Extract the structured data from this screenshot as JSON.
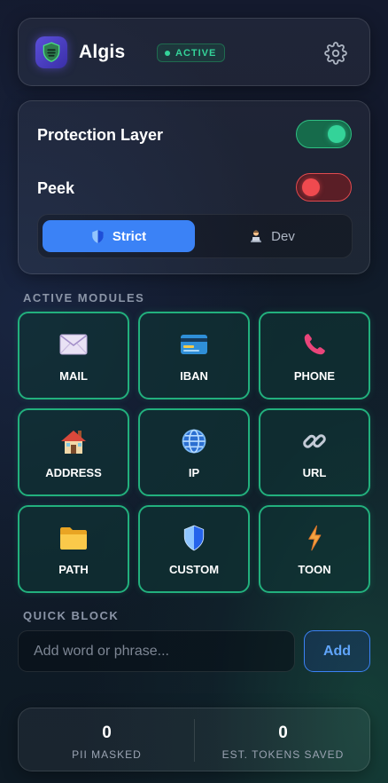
{
  "header": {
    "app_name": "Algis",
    "status": "ACTIVE",
    "logo_icon": "shield-logo-icon",
    "settings_icon": "gear-icon"
  },
  "settings": {
    "protection_layer": {
      "label": "Protection Layer",
      "enabled": true
    },
    "peek": {
      "label": "Peek",
      "enabled": false
    },
    "modes": [
      {
        "label": "Strict",
        "icon": "shield-icon",
        "selected": true
      },
      {
        "label": "Dev",
        "icon": "technologist-icon",
        "selected": false
      }
    ]
  },
  "modules": {
    "section_label": "ACTIVE MODULES",
    "items": [
      {
        "label": "MAIL",
        "icon": "envelope-icon"
      },
      {
        "label": "IBAN",
        "icon": "credit-card-icon"
      },
      {
        "label": "PHONE",
        "icon": "phone-icon"
      },
      {
        "label": "ADDRESS",
        "icon": "house-icon"
      },
      {
        "label": "IP",
        "icon": "globe-icon"
      },
      {
        "label": "URL",
        "icon": "link-icon"
      },
      {
        "label": "PATH",
        "icon": "folder-icon"
      },
      {
        "label": "CUSTOM",
        "icon": "shield-icon"
      },
      {
        "label": "TOON",
        "icon": "lightning-icon"
      }
    ]
  },
  "quick_block": {
    "section_label": "QUICK BLOCK",
    "input_value": "",
    "placeholder": "Add word or phrase...",
    "add_label": "Add"
  },
  "stats": {
    "pii_masked": {
      "value": "0",
      "label": "PII MASKED"
    },
    "tokens_saved": {
      "value": "0",
      "label": "EST. TOKENS SAVED"
    }
  },
  "colors": {
    "accent_green": "#34d399",
    "accent_blue": "#3b82f6",
    "danger_red": "#f04a4f",
    "module_border": "#22b07d"
  }
}
